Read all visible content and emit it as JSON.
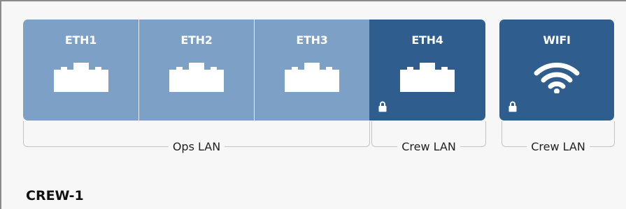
{
  "ports": [
    {
      "label": "ETH1",
      "icon": "ethernet-port-icon",
      "locked": false
    },
    {
      "label": "ETH2",
      "icon": "ethernet-port-icon",
      "locked": false
    },
    {
      "label": "ETH3",
      "icon": "ethernet-port-icon",
      "locked": false
    },
    {
      "label": "ETH4",
      "icon": "ethernet-port-icon",
      "locked": true
    },
    {
      "label": "WIFI",
      "icon": "wifi-icon",
      "locked": true
    }
  ],
  "groups": [
    {
      "label": "Ops LAN"
    },
    {
      "label": "Crew LAN"
    },
    {
      "label": "Crew LAN"
    }
  ],
  "device": {
    "name": "CREW-1"
  },
  "colors": {
    "light_port": "#7da0c6",
    "dark_port": "#2e5d8e"
  }
}
